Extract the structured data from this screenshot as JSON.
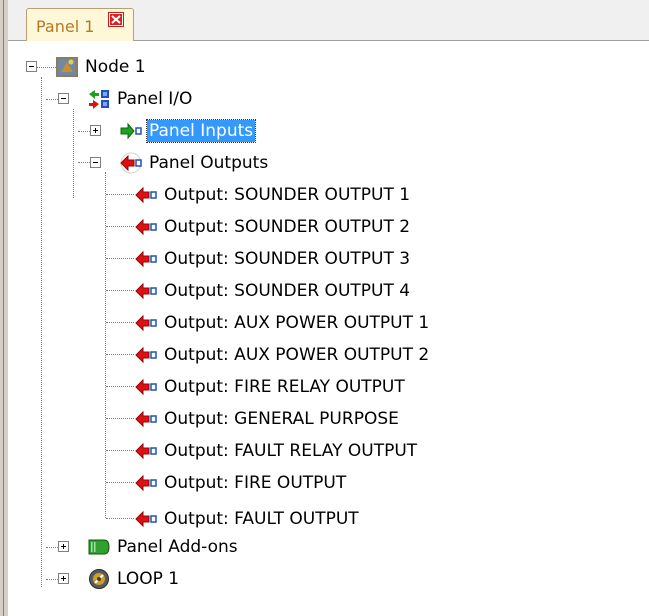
{
  "tabs": [
    {
      "label": "Panel 1",
      "close_icon": "close-icon",
      "accent": "#b07a2a",
      "close_color": "#c02020"
    }
  ],
  "tree": {
    "root": {
      "label": "Node 1",
      "icon": "node-icon",
      "expanded": true
    },
    "panel_io": {
      "label": "Panel I/O",
      "icon": "panel-io-icon",
      "expanded": true
    },
    "panel_inputs": {
      "label": "Panel Inputs",
      "icon": "input-arrow-icon",
      "expanded": false,
      "selected": true
    },
    "panel_outputs": {
      "label": "Panel Outputs",
      "icon": "output-arrow-icon",
      "expanded": true
    },
    "outputs": [
      {
        "label": "Output: SOUNDER OUTPUT 1"
      },
      {
        "label": "Output: SOUNDER OUTPUT 2"
      },
      {
        "label": "Output: SOUNDER OUTPUT 3"
      },
      {
        "label": "Output: SOUNDER OUTPUT 4"
      },
      {
        "label": "Output: AUX POWER OUTPUT 1"
      },
      {
        "label": "Output: AUX POWER OUTPUT 2"
      },
      {
        "label": "Output: FIRE RELAY OUTPUT"
      },
      {
        "label": "Output: GENERAL PURPOSE"
      },
      {
        "label": "Output: FAULT RELAY OUTPUT"
      },
      {
        "label": "Output: FIRE OUTPUT"
      },
      {
        "label": "Output: FAULT OUTPUT"
      }
    ],
    "panel_addons": {
      "label": "Panel Add-ons",
      "icon": "addon-card-icon",
      "expanded": false
    },
    "loop1": {
      "label": "LOOP 1",
      "icon": "loop-icon",
      "expanded": false
    }
  },
  "colors": {
    "selection": "#3399ff",
    "output_arrow": "#e01010",
    "input_arrow": "#20a020"
  }
}
